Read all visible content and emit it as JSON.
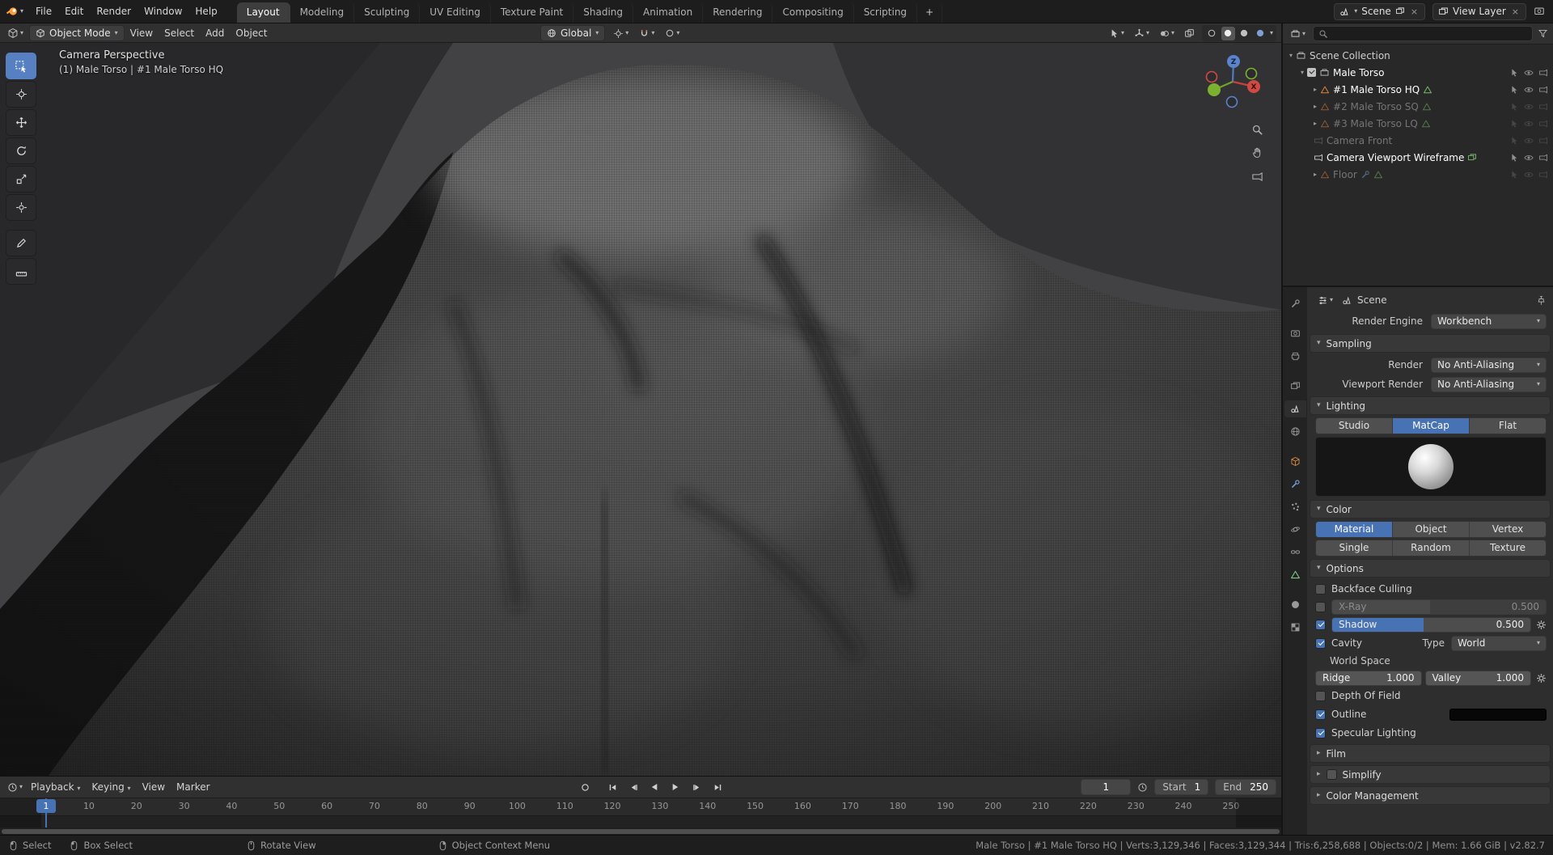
{
  "topbar": {
    "menus": [
      "File",
      "Edit",
      "Render",
      "Window",
      "Help"
    ],
    "workspaces": [
      "Layout",
      "Modeling",
      "Sculpting",
      "UV Editing",
      "Texture Paint",
      "Shading",
      "Animation",
      "Rendering",
      "Compositing",
      "Scripting"
    ],
    "active_workspace": "Layout",
    "add_workspace": "+",
    "scene": "Scene",
    "view_layer": "View Layer",
    "close_glyph": "×"
  },
  "viewport": {
    "header": {
      "mode": "Object Mode",
      "menus": [
        "View",
        "Select",
        "Add",
        "Object"
      ],
      "orientation": "Global"
    },
    "overlay": {
      "line1": "Camera Perspective",
      "line2": "(1) Male Torso | #1 Male Torso HQ"
    },
    "gizmo": {
      "x_label": "X",
      "z_label": "Z"
    }
  },
  "outliner": {
    "search_placeholder": "",
    "root": "Scene Collection",
    "rows": [
      {
        "label": "Male Torso"
      },
      {
        "label": "#1 Male Torso HQ"
      },
      {
        "label": "#2 Male Torso SQ"
      },
      {
        "label": "#3 Male Torso LQ"
      },
      {
        "label": "Camera Front"
      },
      {
        "label": "Camera Viewport Wireframe"
      },
      {
        "label": "Floor"
      }
    ]
  },
  "properties": {
    "breadcrumb": "Scene",
    "render_engine": {
      "label": "Render Engine",
      "value": "Workbench"
    },
    "sampling": {
      "title": "Sampling",
      "render": {
        "label": "Render",
        "value": "No Anti-Aliasing"
      },
      "viewport_render": {
        "label": "Viewport Render",
        "value": "No Anti-Aliasing"
      }
    },
    "lighting": {
      "title": "Lighting",
      "options": [
        "Studio",
        "MatCap",
        "Flat"
      ],
      "active": "MatCap"
    },
    "color": {
      "title": "Color",
      "row1": [
        "Material",
        "Object",
        "Vertex"
      ],
      "row2": [
        "Single",
        "Random",
        "Texture"
      ],
      "active": "Material"
    },
    "options": {
      "title": "Options",
      "backface_culling": {
        "label": "Backface Culling",
        "checked": false
      },
      "xray": {
        "label": "X-Ray",
        "value": "0.500",
        "checked": false
      },
      "shadow": {
        "label": "Shadow",
        "value": "0.500",
        "checked": true
      },
      "cavity": {
        "label": "Cavity",
        "checked": true,
        "type_label": "Type",
        "type_value": "World"
      },
      "world_space": "World Space",
      "ridge": {
        "label": "Ridge",
        "value": "1.000"
      },
      "valley": {
        "label": "Valley",
        "value": "1.000"
      },
      "depth_of_field": {
        "label": "Depth Of Field",
        "checked": false
      },
      "outline": {
        "label": "Outline",
        "checked": true
      },
      "specular": {
        "label": "Specular Lighting",
        "checked": true
      }
    },
    "film": "Film",
    "simplify": "Simplify",
    "color_management": "Color Management"
  },
  "timeline": {
    "menus": [
      "Playback",
      "Keying",
      "View",
      "Marker"
    ],
    "current_frame": "1",
    "start_label": "Start",
    "start": "1",
    "end_label": "End",
    "end": "250",
    "ticks": [
      1,
      10,
      20,
      30,
      40,
      50,
      60,
      70,
      80,
      90,
      100,
      110,
      120,
      130,
      140,
      150,
      160,
      170,
      180,
      190,
      200,
      210,
      220,
      230,
      240,
      250
    ]
  },
  "statusbar": {
    "left": [
      {
        "label": "Select"
      },
      {
        "label": "Box Select"
      },
      {
        "label": "Rotate View"
      },
      {
        "label": "Object Context Menu"
      }
    ],
    "right": "Male Torso | #1 Male Torso HQ | Verts:3,129,346 | Faces:3,129,344 | Tris:6,258,688 | Objects:0/2 | Mem: 1.66 GiB | v2.82.7"
  },
  "colors": {
    "accent": "#4772b3",
    "object_orange": "#e0823d",
    "data_green": "#77bb6a"
  }
}
